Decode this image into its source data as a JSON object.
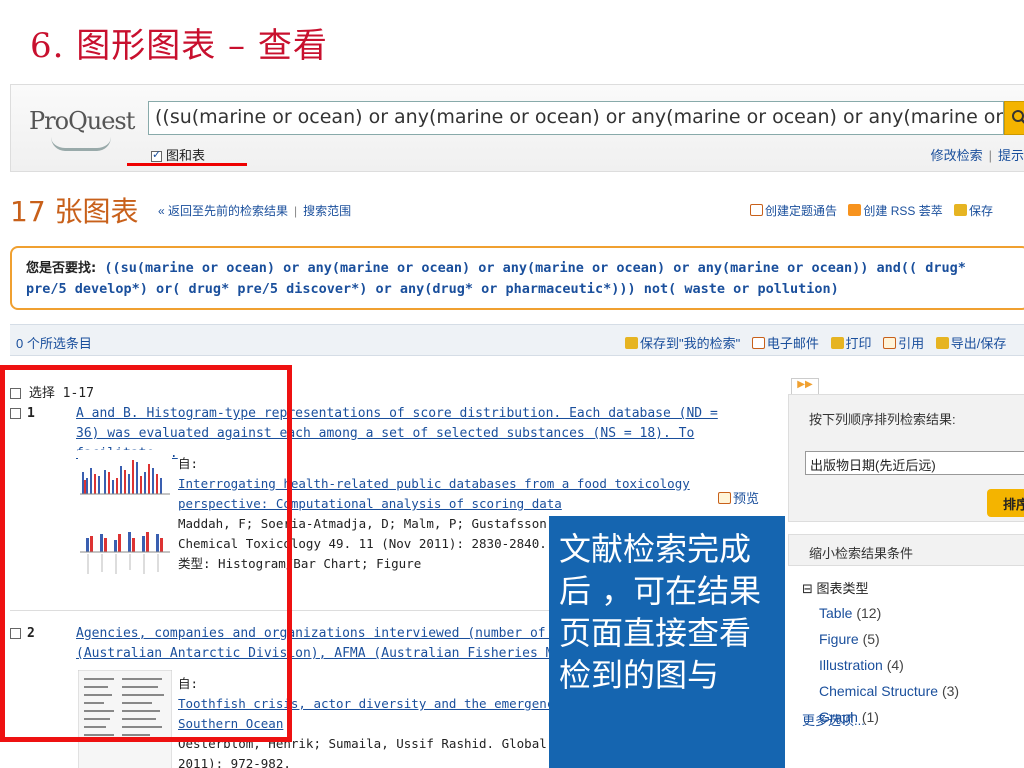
{
  "slide": {
    "title": "6. 图形图表  –  查看"
  },
  "header": {
    "logo": "ProQuest",
    "search_value": "((su(marine or ocean) or any(marine or ocean) or any(marine or ocean) or any(marine or ocea",
    "filter_label": "图和表",
    "links": [
      "修改检索",
      "提示"
    ]
  },
  "results": {
    "title": "17 张图表",
    "back_link": "« 返回至先前的检索结果",
    "scope_link": "搜索范围",
    "top_actions": [
      "创建定题通告",
      "创建 RSS 荟萃",
      "保存"
    ]
  },
  "suggest": {
    "lead": "您是否要找:",
    "query": "((su(marine or ocean) or any(marine or ocean) or any(marine or ocean) or any(marine or ocean)) and(( drug* pre/5 develop*) or( drug* pre/5 discover*) or any(drug* or pharmaceutic*))) not( waste or pollution)"
  },
  "selection_bar": {
    "count": "0 个所选条目",
    "actions": [
      "保存到\"我的检索\"",
      "电子邮件",
      "打印",
      "引用",
      "导出/保存"
    ]
  },
  "list": {
    "select_all": "选择 1-17",
    "records": [
      {
        "num": "1",
        "title": "A and B. Histogram-type representations of score distribution. Each database (ND = 36) was evaluated against each among a set of selected substances (NS = 18). To facilitate...",
        "from_label": "自:",
        "source_title": "Interrogating health-related public databases from a food toxicology perspective: Computational analysis of scoring data",
        "authors": "Maddah, F; Soeria-Atmadja, D; Malm, P; Gustafsson, M G;",
        "journal": "Chemical Toxicology 49. 11 (Nov 2011): 2830-2840.",
        "type": "类型: Histogram/Bar Chart; Figure",
        "preview": "预览"
      },
      {
        "num": "2",
        "title": "Agencies, companies and organizations interviewed (number of interviewees) AAD (Australian Antarctic Division), AFMA (Australian Fisheries Management",
        "from_label": "自:",
        "source_title": "Toothfish crisis, actor diversity and the emergence of mechanisms in the Southern Ocean",
        "authors": "Oesterblom, Henrik; Sumaila, Ussif Rashid. Global Envir",
        "journal": "2011): 972-982."
      }
    ]
  },
  "sidebar": {
    "sort_label": "按下列顺序排列检索结果:",
    "sort_value": "出版物日期(先近后远)",
    "sort_button": "排序",
    "narrow_label": "缩小检索结果条件",
    "facet_group": "图表类型",
    "facets": [
      {
        "label": "Table",
        "count": "(12)"
      },
      {
        "label": "Figure",
        "count": "(5)"
      },
      {
        "label": "Illustration",
        "count": "(4)"
      },
      {
        "label": "Chemical Structure",
        "count": "(3)"
      },
      {
        "label": "Graph",
        "count": "(1)"
      }
    ],
    "more": "更多选项..."
  },
  "callout": {
    "text": "文献检索完成后 ，可在结果页面直接查看检到的图与"
  },
  "colors": {
    "accent_red": "#ee1111",
    "proquest_orange": "#c8601a",
    "callout_blue": "#1565b0",
    "link_blue": "#1a4f9c"
  }
}
